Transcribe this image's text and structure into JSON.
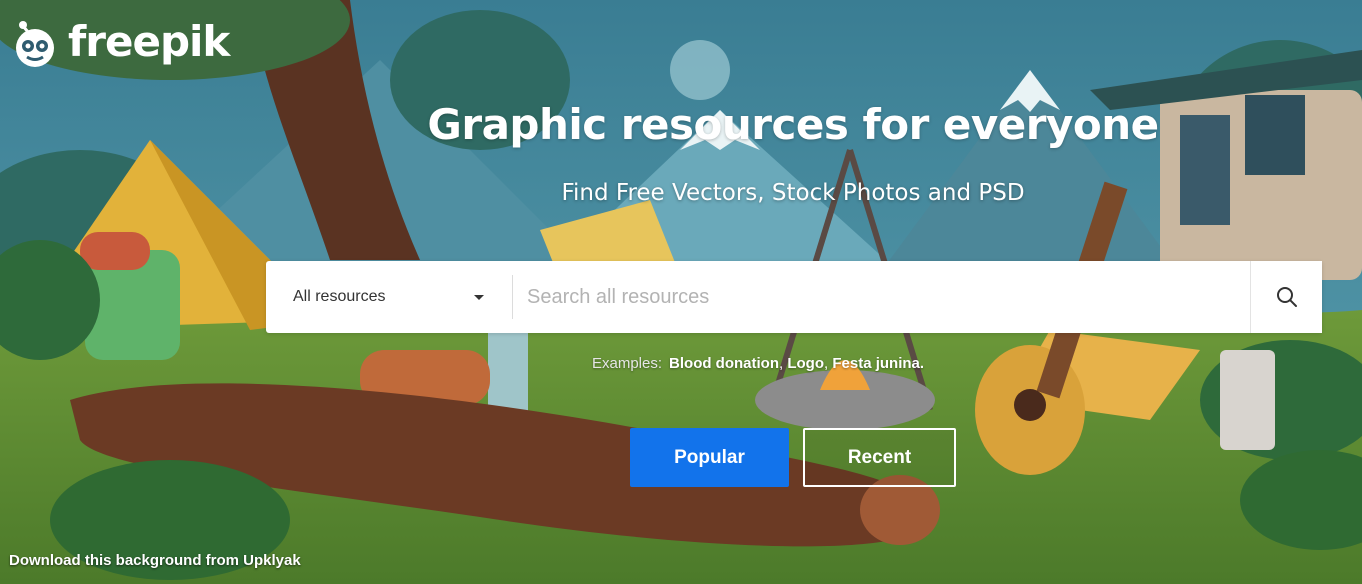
{
  "brand": {
    "name": "freepik",
    "accent_color": "#1273eb"
  },
  "hero": {
    "title": "Graphic resources for everyone",
    "subtitle": "Find Free Vectors, Stock Photos and PSD",
    "credit": "Download this background from Upklyak"
  },
  "search": {
    "category_selected": "All resources",
    "placeholder": "Search all resources",
    "value": "",
    "button_icon": "search-icon",
    "examples_label": "Examples:",
    "examples": [
      "Blood donation",
      "Logo",
      "Festa junina."
    ]
  },
  "sort_buttons": {
    "popular_label": "Popular",
    "recent_label": "Recent"
  },
  "colors": {
    "popular_button": "#1273eb",
    "text_on_hero": "#ffffff"
  }
}
